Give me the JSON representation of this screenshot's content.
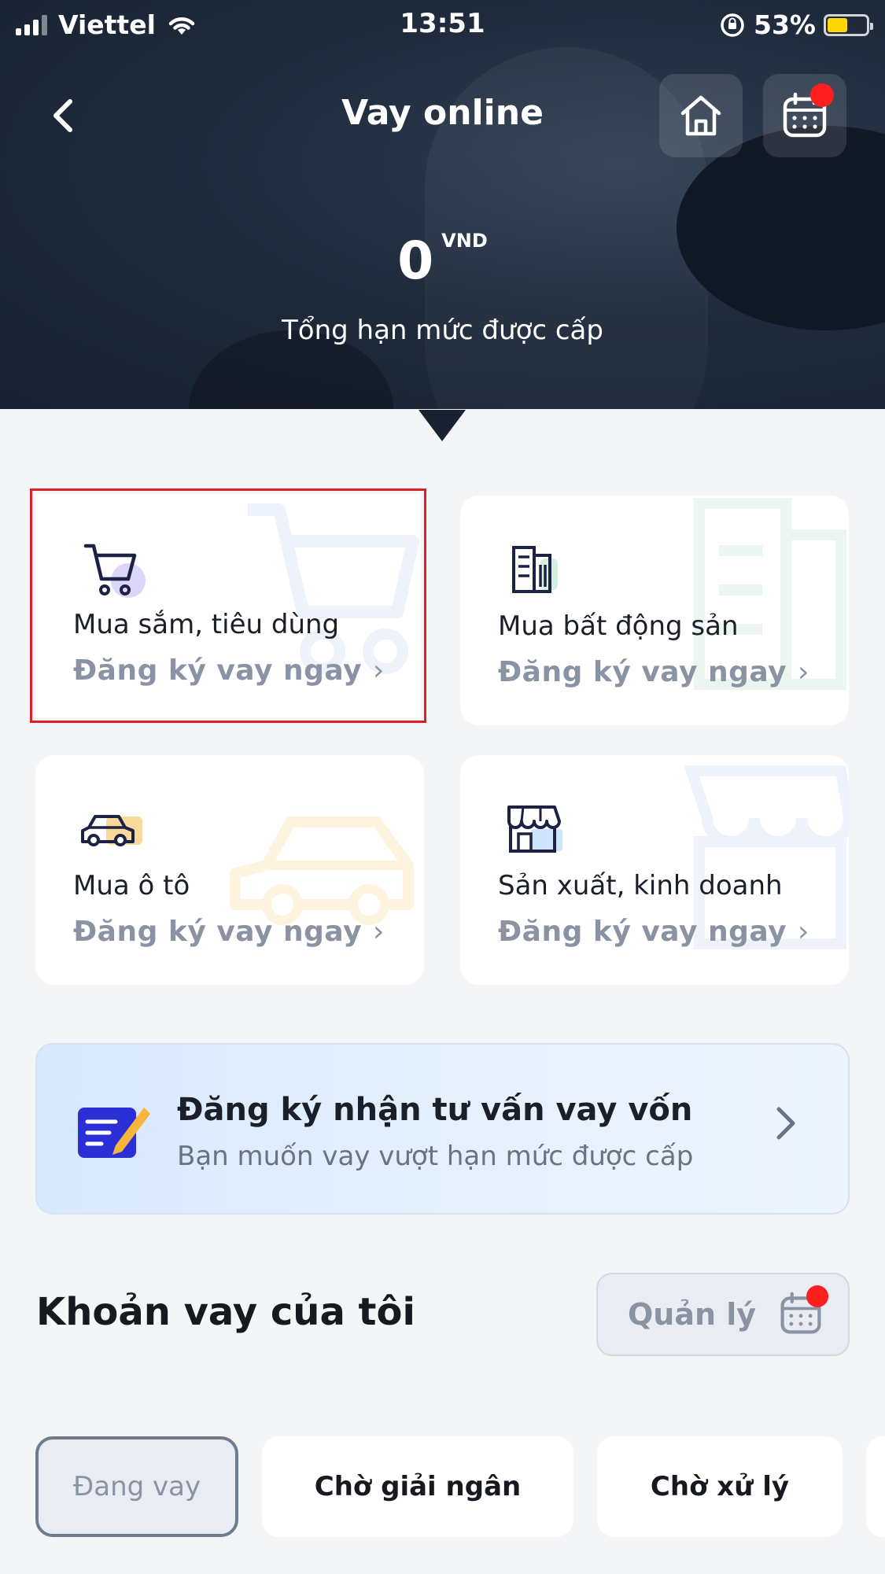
{
  "status_bar": {
    "carrier": "Viettel",
    "time": "13:51",
    "battery": "53%"
  },
  "header": {
    "title": "Vay online"
  },
  "limit": {
    "value": "0",
    "unit": "VND",
    "label": "Tổng hạn mức được cấp"
  },
  "categories": [
    {
      "title": "Mua sắm, tiêu dùng",
      "action": "Đăng ký vay ngay",
      "icon": "shopping-cart-icon"
    },
    {
      "title": "Mua bất động sản",
      "action": "Đăng ký vay ngay",
      "icon": "building-icon"
    },
    {
      "title": "Mua ô tô",
      "action": "Đăng ký vay ngay",
      "icon": "car-icon"
    },
    {
      "title": "Sản xuất, kinh doanh",
      "action": "Đăng ký vay ngay",
      "icon": "store-icon"
    }
  ],
  "consult": {
    "title": "Đăng ký nhận tư vấn vay vốn",
    "subtitle": "Bạn muốn vay vượt hạn mức được cấp"
  },
  "my_loans": {
    "title": "Khoản vay của tôi",
    "manage_label": "Quản lý"
  },
  "tabs": [
    "Đang vay",
    "Chờ giải ngân",
    "Chờ xử lý"
  ],
  "colors": {
    "header_bg": "#1f2b3c",
    "accent_red": "#ff1f1f",
    "highlight_outline": "#e01e2a",
    "muted_text": "#8a93a3"
  }
}
